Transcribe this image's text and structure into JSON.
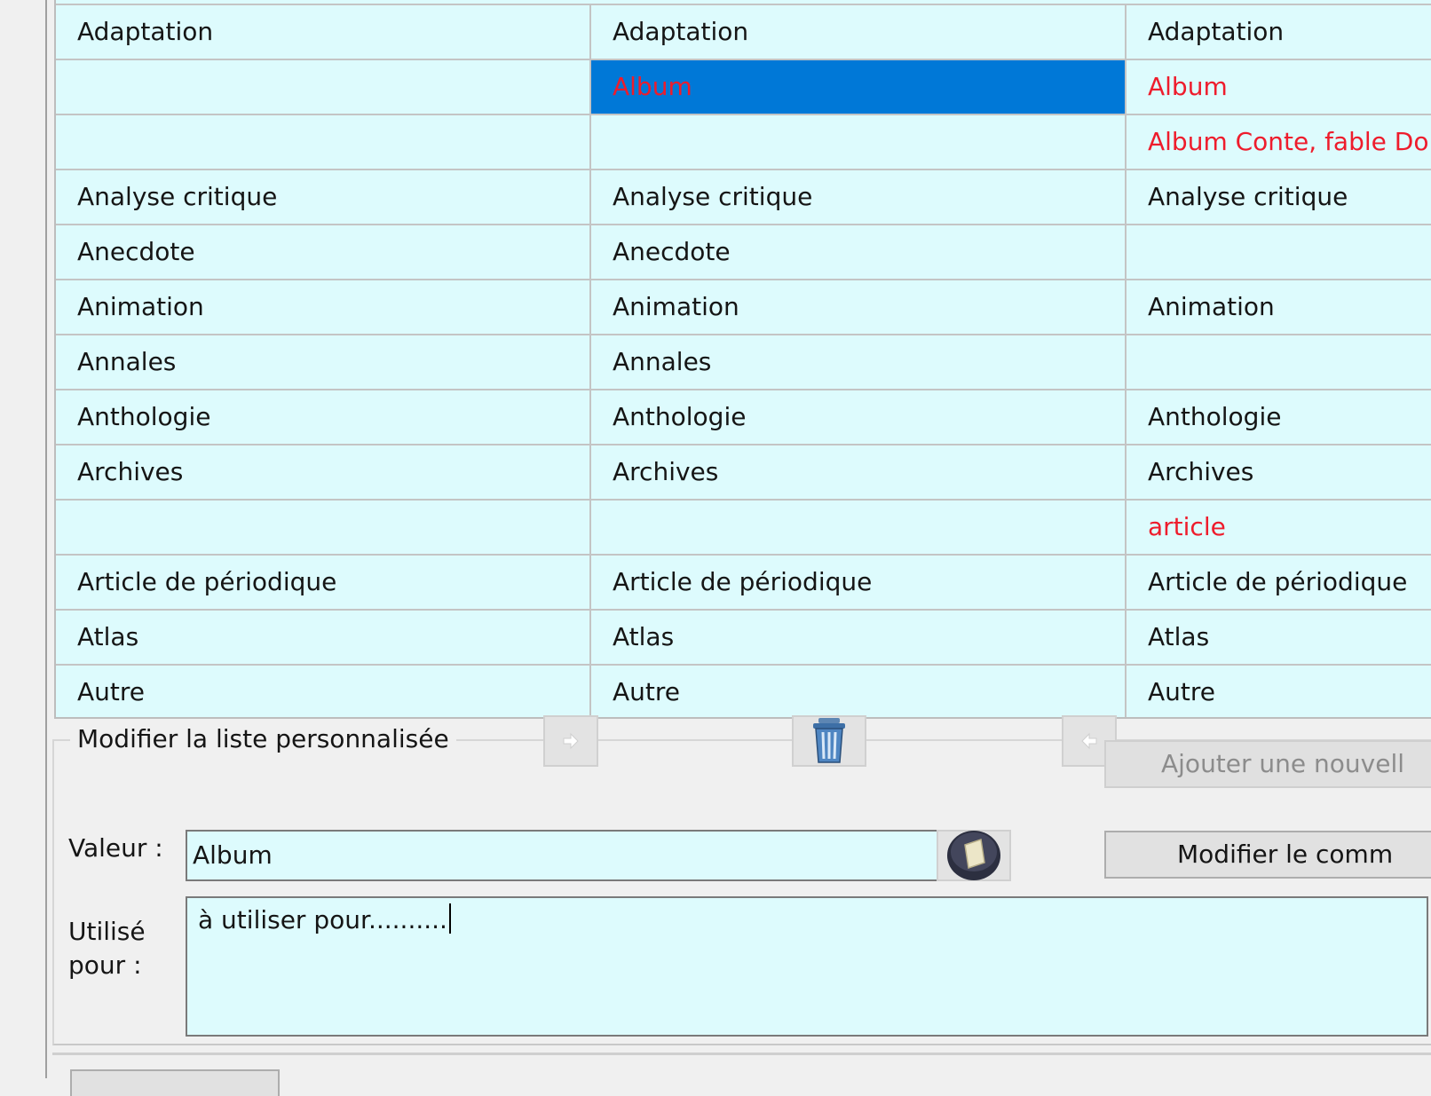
{
  "table": {
    "rows": [
      {
        "c1": "Adaptation",
        "c2": "Adaptation",
        "c3": "Adaptation",
        "c3_red": false,
        "selected": false
      },
      {
        "c1": "",
        "c2": "Album",
        "c3": "Album",
        "c3_red": true,
        "selected": true
      },
      {
        "c1": "",
        "c2": "",
        "c3": "Album Conte, fable Do",
        "c3_red": true,
        "selected": false
      },
      {
        "c1": "Analyse critique",
        "c2": "Analyse critique",
        "c3": "Analyse critique",
        "c3_red": false,
        "selected": false
      },
      {
        "c1": "Anecdote",
        "c2": "Anecdote",
        "c3": "",
        "c3_red": false,
        "selected": false
      },
      {
        "c1": "Animation",
        "c2": "Animation",
        "c3": "Animation",
        "c3_red": false,
        "selected": false
      },
      {
        "c1": "Annales",
        "c2": "Annales",
        "c3": "",
        "c3_red": false,
        "selected": false
      },
      {
        "c1": "Anthologie",
        "c2": "Anthologie",
        "c3": "Anthologie",
        "c3_red": false,
        "selected": false
      },
      {
        "c1": "Archives",
        "c2": "Archives",
        "c3": "Archives",
        "c3_red": false,
        "selected": false
      },
      {
        "c1": "",
        "c2": "",
        "c3": "article",
        "c3_red": true,
        "selected": false
      },
      {
        "c1": "Article de périodique",
        "c2": "Article de périodique",
        "c3": "Article de périodique",
        "c3_red": false,
        "selected": false
      },
      {
        "c1": "Atlas",
        "c2": "Atlas",
        "c3": "Atlas",
        "c3_red": false,
        "selected": false
      },
      {
        "c1": "Autre",
        "c2": "Autre",
        "c3": "Autre",
        "c3_red": false,
        "selected": false
      }
    ]
  },
  "edit_panel": {
    "legend": "Modifier la liste personnalisée",
    "add_new_label": "Ajouter une nouvell",
    "modify_comment_label": "Modifier le comm",
    "value_label": "Valeur :",
    "value": "Album",
    "used_for_label_line1": "Utilisé",
    "used_for_label_line2": "pour :",
    "used_for_value": "à utiliser pour.........."
  },
  "icons": {
    "move_right": "arrow-right-icon",
    "delete": "trash-icon",
    "move_left": "arrow-left-icon",
    "edit_note": "note-icon"
  },
  "colors": {
    "row_background": "#ddfbfd",
    "selection": "#0078d7",
    "red_text": "#ee1c2c"
  }
}
